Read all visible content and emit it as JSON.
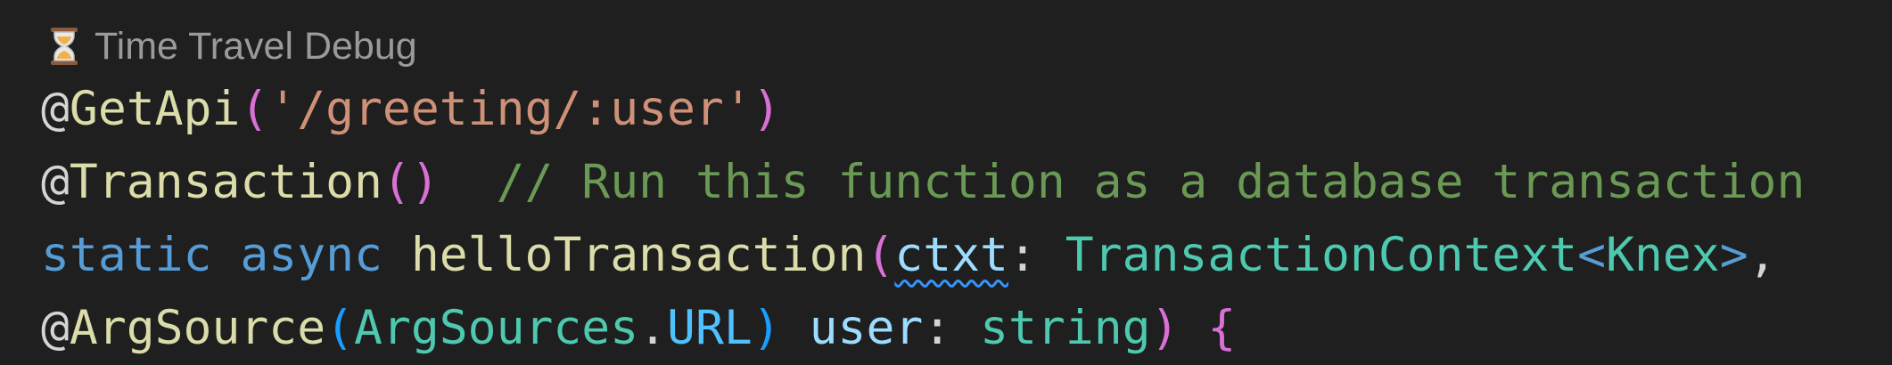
{
  "codelens": {
    "icon": "hourglass-icon",
    "label": "Time Travel Debug"
  },
  "code": {
    "line1": {
      "at": "@",
      "decorator": "GetApi",
      "open": "(",
      "string": "'/greeting/:user'",
      "close": ")"
    },
    "line2": {
      "at": "@",
      "decorator": "Transaction",
      "parens": "()",
      "comment": "// Run this function as a database transaction"
    },
    "line3": {
      "kw_static": "static",
      "kw_async": "async",
      "func": "helloTransaction",
      "open": "(",
      "param": "ctxt",
      "colon": ": ",
      "type": "TransactionContext",
      "lt": "<",
      "generic": "Knex",
      "gt": ">",
      "comma": ","
    },
    "line4": {
      "at": "@",
      "decorator": "ArgSource",
      "open": "(",
      "enum": "ArgSources",
      "dot": ".",
      "member": "URL",
      "close_inner": ")",
      "param": "user",
      "colon": ": ",
      "type": "string",
      "close": ")",
      "brace": "{"
    }
  },
  "colors": {
    "background": "#1f1f1f",
    "decorator": "#dcdcaa",
    "string": "#ce9178",
    "comment": "#6a9955",
    "keyword": "#569cd6",
    "type": "#4ec9b0",
    "parameter": "#9cdcfe",
    "bracket_level1": "#da70d6",
    "bracket_level2": "#179fff",
    "codelens": "#9a9a9a"
  }
}
